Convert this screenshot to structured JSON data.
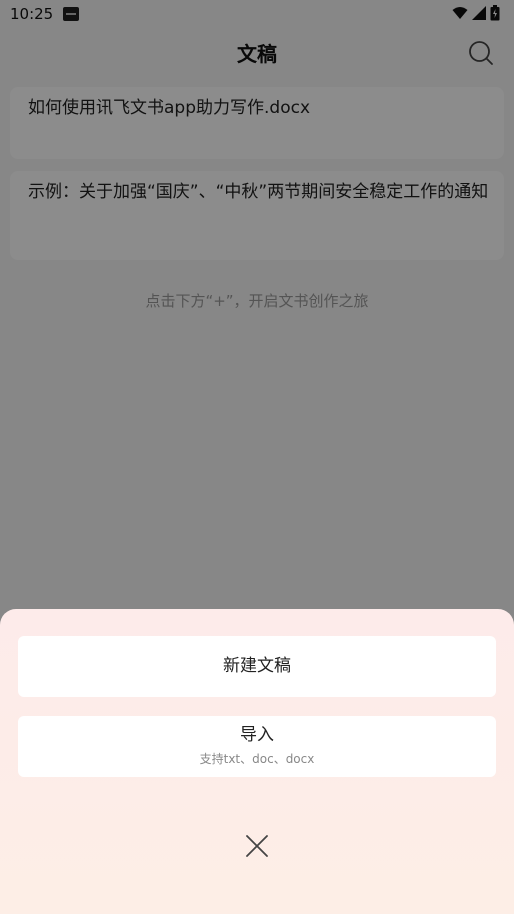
{
  "status_bar": {
    "time": "10:25",
    "icons": [
      "app-notification-icon",
      "wifi-icon",
      "signal-icon",
      "battery-icon"
    ]
  },
  "header": {
    "title": "文稿",
    "search_icon": "search-icon"
  },
  "documents": [
    {
      "title": "如何使用讯飞文书app助力写作.docx"
    },
    {
      "title": "示例：关于加强“国庆”、“中秋”两节期间安全稳定工作的通知"
    }
  ],
  "empty_hint": "点击下方“+”，开启文书创作之旅",
  "bottom_sheet": {
    "new_doc_label": "新建文稿",
    "import_label": "导入",
    "import_hint": "支持txt、doc、docx",
    "close_icon": "close-icon"
  },
  "colors": {
    "overlay": "rgba(0,0,0,0.45)",
    "sheet_top": "#fdebea",
    "sheet_bottom": "#fdeee6"
  }
}
